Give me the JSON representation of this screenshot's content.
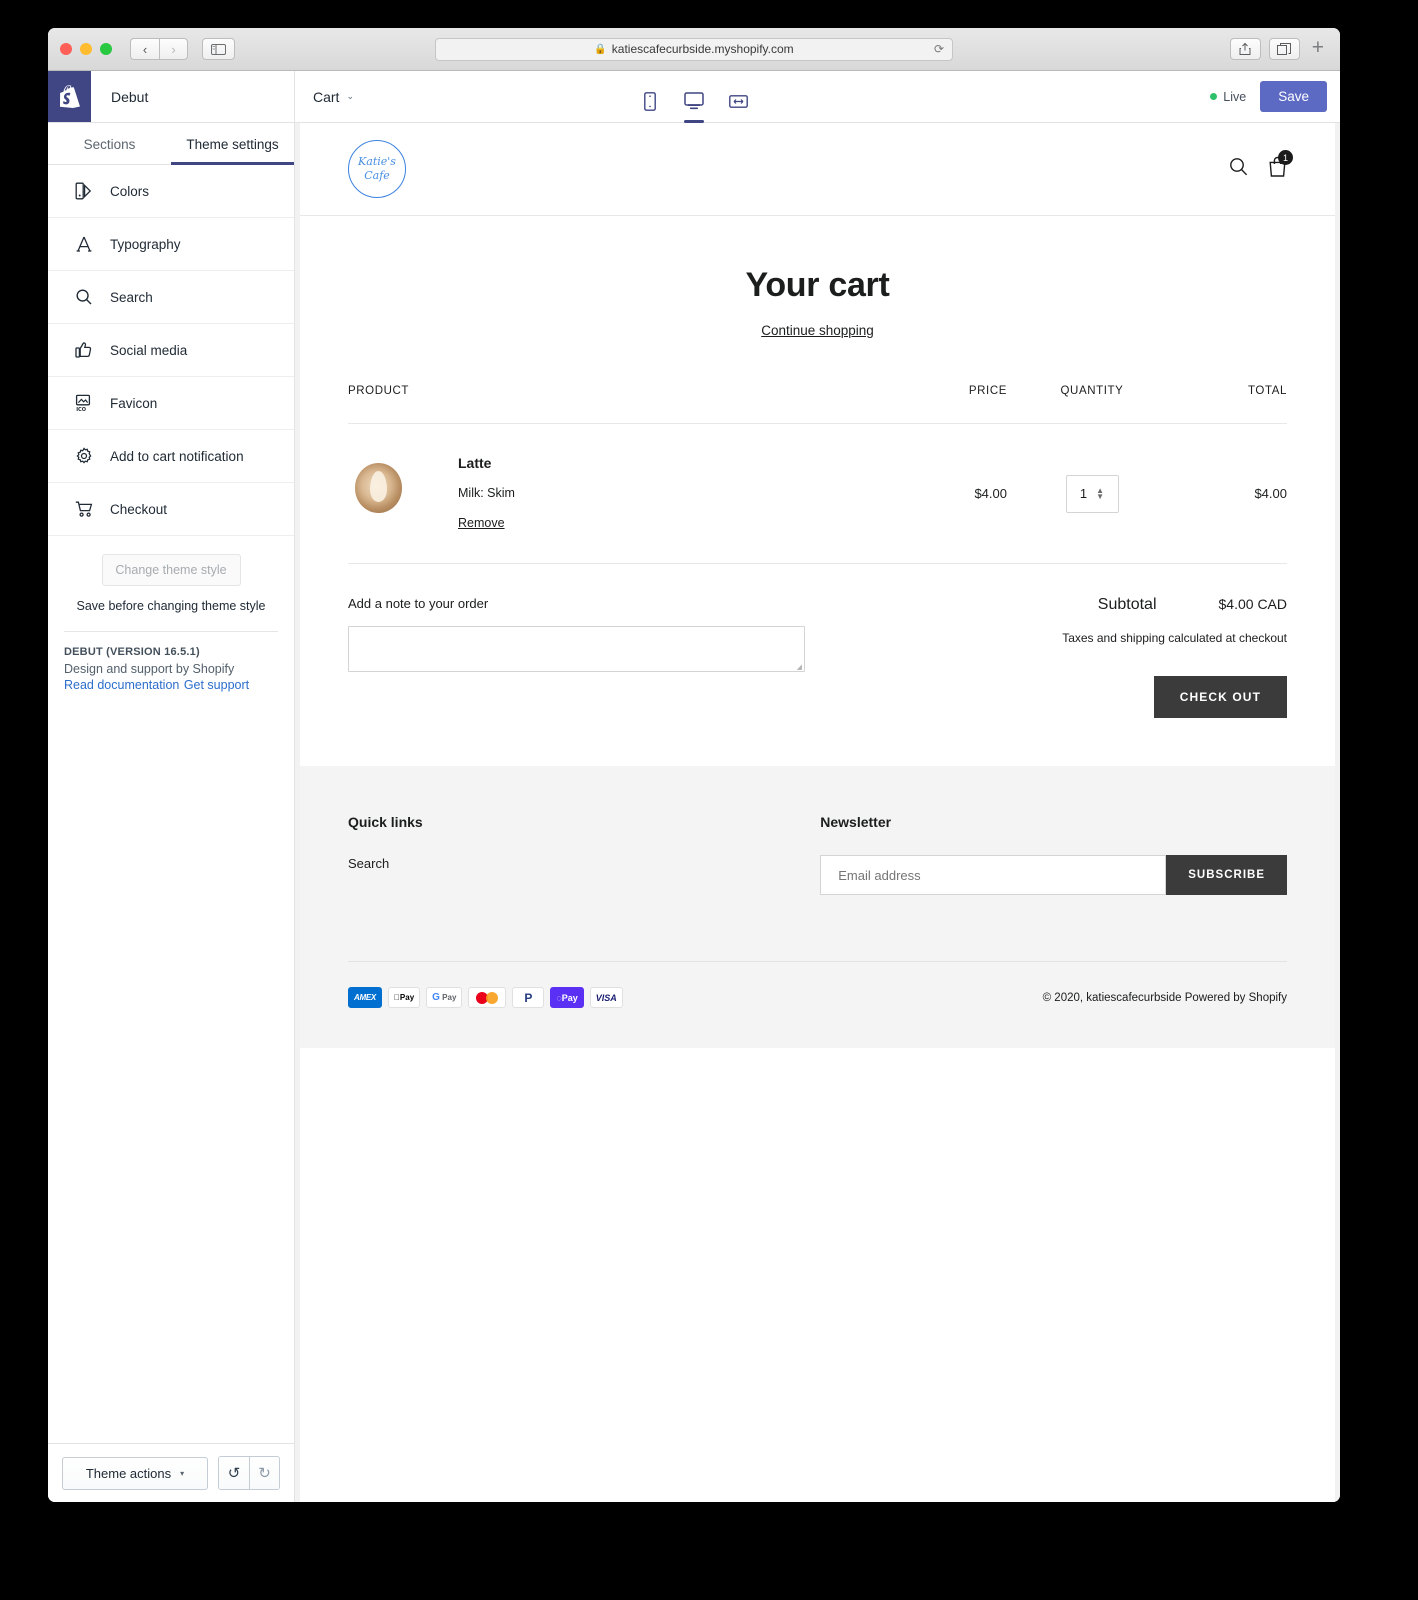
{
  "browser": {
    "url": "katiescafecurbside.myshopify.com",
    "lock_icon": "lock-icon",
    "back_glyph": "‹",
    "forward_glyph": "›",
    "reload_glyph": "⟳",
    "sidebar_icon": "sidebar-toggle-icon",
    "share_icon": "share-icon",
    "tabs_icon": "tab-overview-icon",
    "new_tab_glyph": "+"
  },
  "topbar": {
    "theme_name": "Debut",
    "page_selector": "Cart",
    "chevron": "⌄",
    "devices": [
      {
        "name": "mobile-preview",
        "glyph": "mobile"
      },
      {
        "name": "desktop-preview",
        "glyph": "desktop"
      },
      {
        "name": "fullwidth-preview",
        "glyph": "fullwidth"
      }
    ],
    "live_label": "Live",
    "save_label": "Save",
    "accent_color": "#5c6ac4",
    "live_color": "#2ec16b"
  },
  "sidebar": {
    "tabs": [
      {
        "label": "Sections",
        "active": false
      },
      {
        "label": "Theme settings",
        "active": true
      }
    ],
    "items": [
      {
        "label": "Colors",
        "icon": "colors-icon"
      },
      {
        "label": "Typography",
        "icon": "typography-icon"
      },
      {
        "label": "Search",
        "icon": "search-icon"
      },
      {
        "label": "Social media",
        "icon": "thumbs-up-icon"
      },
      {
        "label": "Favicon",
        "icon": "favicon-icon"
      },
      {
        "label": "Add to cart notification",
        "icon": "gear-icon"
      },
      {
        "label": "Checkout",
        "icon": "cart-icon"
      }
    ],
    "change_theme_style": "Change theme style",
    "save_hint": "Save before changing theme style",
    "version": "DEBUT (VERSION 16.5.1)",
    "support_line": "Design and support by Shopify",
    "read_documentation": "Read documentation",
    "get_support": "Get support",
    "theme_actions": "Theme actions",
    "theme_actions_chevron": "▾",
    "undo_glyph": "↺",
    "redo_glyph": "↻"
  },
  "store": {
    "logo_line1": "Katie's",
    "logo_line2": "Cafe",
    "logo_color": "#4a90e2",
    "search_icon": "search-icon",
    "cart_icon": "shopping-bag-icon",
    "cart_count": "1",
    "title": "Your cart",
    "continue_shopping": "Continue shopping",
    "table_headers": {
      "product": "PRODUCT",
      "price": "PRICE",
      "quantity": "QUANTITY",
      "total": "TOTAL"
    },
    "items": [
      {
        "name": "Latte",
        "variant": "Milk: Skim",
        "remove": "Remove",
        "price": "$4.00",
        "quantity": "1",
        "total": "$4.00",
        "image": "latte-photo"
      }
    ],
    "note_label": "Add a note to your order",
    "note_value": "",
    "subtotal_label": "Subtotal",
    "subtotal_value": "$4.00 CAD",
    "tax_note": "Taxes and shipping calculated at checkout",
    "checkout_label": "CHECK OUT"
  },
  "footer": {
    "quick_links_title": "Quick links",
    "quick_links": [
      "Search"
    ],
    "newsletter_title": "Newsletter",
    "email_placeholder": "Email address",
    "email_value": "",
    "subscribe_label": "SUBSCRIBE",
    "payment_methods": [
      {
        "name": "amex",
        "label": "AMEX"
      },
      {
        "name": "apple-pay",
        "label": "Pay"
      },
      {
        "name": "google-pay",
        "label": "Pay"
      },
      {
        "name": "mastercard",
        "label": ""
      },
      {
        "name": "paypal",
        "label": "P"
      },
      {
        "name": "shop-pay",
        "label": "Pay"
      },
      {
        "name": "visa",
        "label": "VISA"
      }
    ],
    "copyright": "© 2020, katiescafecurbside Powered by Shopify"
  }
}
